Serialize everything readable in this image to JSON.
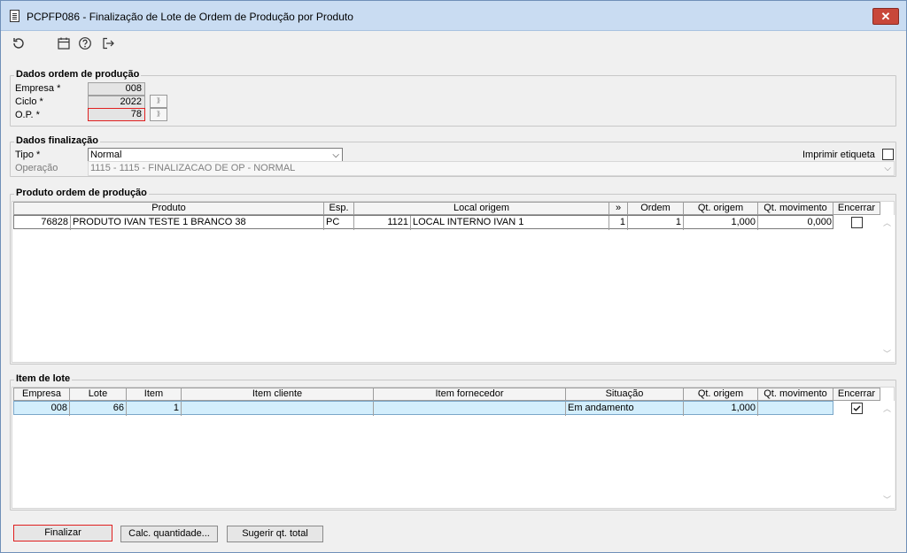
{
  "window": {
    "title": "PCPFP086 - Finalização de Lote de Ordem de Produção por Produto"
  },
  "toolbar": {
    "icons": [
      "refresh-icon",
      "calendar-icon",
      "help-icon",
      "exit-icon"
    ]
  },
  "dados_ordem": {
    "title": "Dados ordem de produção",
    "empresa_label": "Empresa *",
    "empresa_value": "008",
    "ciclo_label": "Ciclo *",
    "ciclo_value": "2022",
    "op_label": "O.P. *",
    "op_value": "78"
  },
  "dados_finalizacao": {
    "title": "Dados finalização",
    "tipo_label": "Tipo *",
    "tipo_value": "Normal",
    "operacao_label": "Operação",
    "operacao_value": "1115 - 1115 - FINALIZACAO DE OP - NORMAL",
    "imprimir_label": "Imprimir etiqueta",
    "imprimir_checked": false
  },
  "produto_grid": {
    "title": "Produto ordem de produção",
    "columns": [
      "Produto",
      "Esp.",
      "Local origem",
      "»",
      "Ordem",
      "Qt. origem",
      "Qt. movimento",
      "Encerrar"
    ],
    "rows": [
      {
        "codigo": "76828",
        "produto": "PRODUTO IVAN TESTE 1 BRANCO 38",
        "esp": "PC",
        "local_cod": "1121",
        "local": "LOCAL INTERNO IVAN 1",
        "seq": "1",
        "ordem": "1",
        "qt_origem": "1,000",
        "qt_movimento": "0,000",
        "encerrar": false
      }
    ]
  },
  "item_lote": {
    "title": "Item de lote",
    "columns": [
      "Empresa",
      "Lote",
      "Item",
      "Item cliente",
      "Item fornecedor",
      "Situação",
      "Qt. origem",
      "Qt. movimento",
      "Encerrar"
    ],
    "rows": [
      {
        "empresa": "008",
        "lote": "66",
        "item": "1",
        "item_cliente": "",
        "item_fornecedor": "",
        "situacao": "Em andamento",
        "qt_origem": "1,000",
        "qt_movimento": "",
        "encerrar": true
      }
    ]
  },
  "buttons": {
    "finalizar": "Finalizar",
    "calc": "Calc. quantidade...",
    "sugerir": "Sugerir qt. total"
  }
}
